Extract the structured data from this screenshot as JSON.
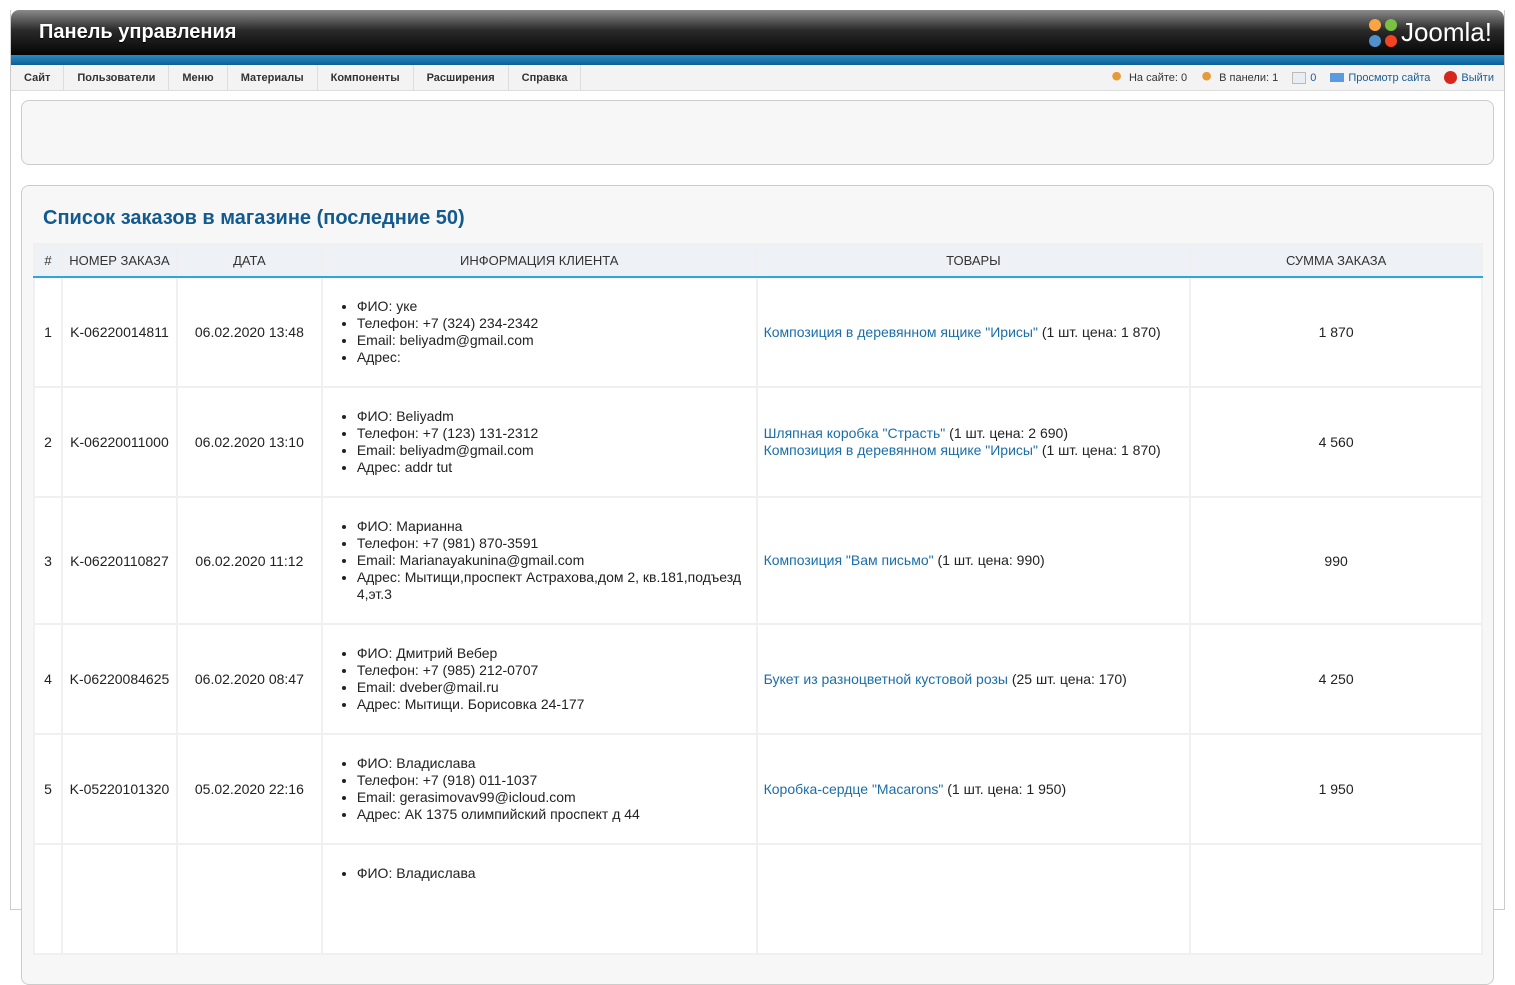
{
  "header": {
    "title": "Панель управления",
    "logo": "Joomla!"
  },
  "menu": [
    "Сайт",
    "Пользователи",
    "Меню",
    "Материалы",
    "Компоненты",
    "Расширения",
    "Справка"
  ],
  "status": {
    "on_site": "На сайте: 0",
    "in_panel": "В панели: 1",
    "messages": "0",
    "view_site": "Просмотр сайта",
    "logout": "Выйти"
  },
  "section_title": "Список заказов в магазине (последние 50)",
  "columns": [
    "#",
    "НОМЕР ЗАКАЗА",
    "ДАТА",
    "ИНФОРМАЦИЯ КЛИЕНТА",
    "ТОВАРЫ",
    "СУММА ЗАКАЗА"
  ],
  "orders": [
    {
      "n": "1",
      "number": "K-06220014811",
      "date": "06.02.2020 13:48",
      "info": [
        "ФИО: уке",
        "Телефон: +7 (324) 234-2342",
        "Email: beliyadm@gmail.com",
        "Адрес:"
      ],
      "items": [
        {
          "name": "Композиция в деревянном ящике \"Ирисы\"",
          "detail": " (1 шт. цена: 1 870)"
        }
      ],
      "sum": "1 870"
    },
    {
      "n": "2",
      "number": "K-06220011000",
      "date": "06.02.2020 13:10",
      "info": [
        "ФИО: Beliyadm",
        "Телефон: +7 (123) 131-2312",
        "Email: beliyadm@gmail.com",
        "Адрес: addr tut"
      ],
      "items": [
        {
          "name": "Шляпная коробка \"Страсть\"",
          "detail": " (1 шт. цена: 2 690)"
        },
        {
          "name": "Композиция в деревянном ящике \"Ирисы\"",
          "detail": " (1 шт. цена: 1 870)"
        }
      ],
      "sum": "4 560"
    },
    {
      "n": "3",
      "number": "K-06220110827",
      "date": "06.02.2020 11:12",
      "info": [
        "ФИО: Марианна",
        "Телефон: +7 (981) 870-3591",
        "Email: Marianayakunina@gmail.com",
        "Адрес: Мытищи,проспект Астрахова,дом 2, кв.181,подъезд 4,эт.3"
      ],
      "items": [
        {
          "name": "Композиция \"Вам письмо\"",
          "detail": " (1 шт. цена: 990)"
        }
      ],
      "sum": "990"
    },
    {
      "n": "4",
      "number": "K-06220084625",
      "date": "06.02.2020 08:47",
      "info": [
        "ФИО: Дмитрий Вебер",
        "Телефон: +7 (985) 212-0707",
        "Email: dveber@mail.ru",
        "Адрес: Мытищи. Борисовка 24-177"
      ],
      "items": [
        {
          "name": "Букет из разноцветной кустовой розы",
          "detail": " (25 шт. цена: 170)"
        }
      ],
      "sum": "4 250"
    },
    {
      "n": "5",
      "number": "K-05220101320",
      "date": "05.02.2020 22:16",
      "info": [
        "ФИО: Владислава",
        "Телефон: +7 (918) 011-1037",
        "Email: gerasimovav99@icloud.com",
        "Адрес: АК 1375 олимпийский проспект д 44"
      ],
      "items": [
        {
          "name": "Коробка-сердце \"Macarons\"",
          "detail": " (1 шт. цена: 1 950)"
        }
      ],
      "sum": "1 950"
    },
    {
      "n": "",
      "number": "",
      "date": "",
      "info": [
        "ФИО: Владислава"
      ],
      "items": [],
      "sum": ""
    }
  ]
}
